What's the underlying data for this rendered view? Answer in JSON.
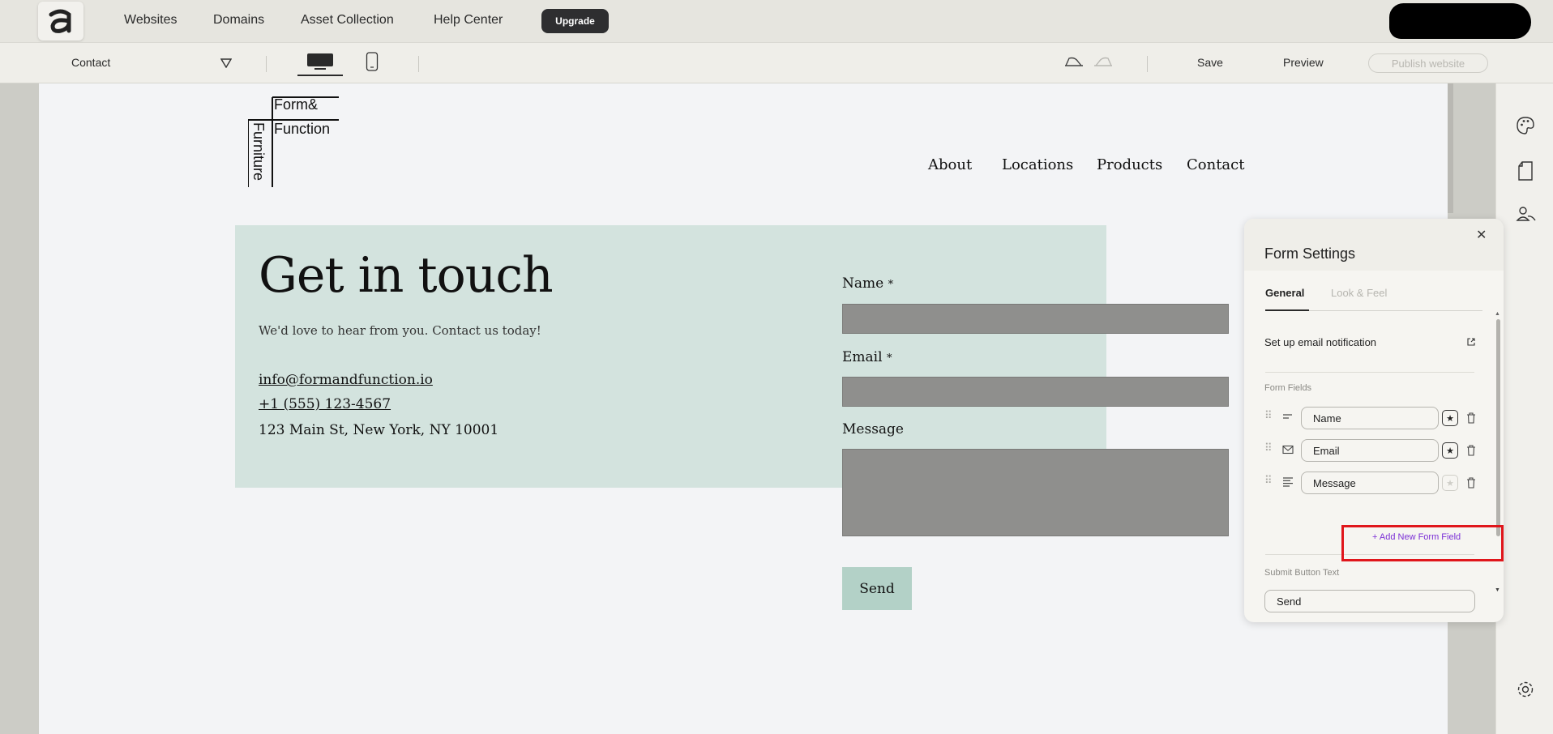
{
  "topnav": {
    "links": [
      "Websites",
      "Domains",
      "Asset Collection",
      "Help Center"
    ],
    "upgrade": "Upgrade"
  },
  "toolbar": {
    "page": "Contact",
    "save": "Save",
    "preview": "Preview",
    "publish": "Publish website"
  },
  "site": {
    "logo": {
      "line1": "Form&",
      "line2": "Function",
      "vertical": "Furniture"
    },
    "nav": [
      "About",
      "Locations",
      "Products",
      "Contact"
    ]
  },
  "contact": {
    "heading": "Get in touch",
    "subtitle": "We'd love to hear from you. Contact us today!",
    "email": "info@formandfunction.io",
    "phone": "+1 (555) 123-4567",
    "address": "123 Main St, New York, NY 10001",
    "form": {
      "name_label": "Name",
      "email_label": "Email",
      "message_label": "Message",
      "required_mark": "*",
      "send": "Send"
    }
  },
  "form_settings": {
    "title": "Form Settings",
    "tabs": [
      "General",
      "Look & Feel"
    ],
    "active_tab": "General",
    "notify": "Set up email notification",
    "fields_section": "Form Fields",
    "fields": [
      {
        "label": "Name",
        "type_icon": "text-short-icon",
        "required": true
      },
      {
        "label": "Email",
        "type_icon": "mail-icon",
        "required": true
      },
      {
        "label": "Message",
        "type_icon": "text-long-icon",
        "required": false
      }
    ],
    "add_field": "+ Add New Form Field",
    "submit_section": "Submit Button Text",
    "submit_value": "Send"
  },
  "colors": {
    "accent_panel": "#d3e3de",
    "send_button": "#b3d1c7",
    "add_field_link": "#7b2fd6",
    "highlight": "#e0161b"
  }
}
